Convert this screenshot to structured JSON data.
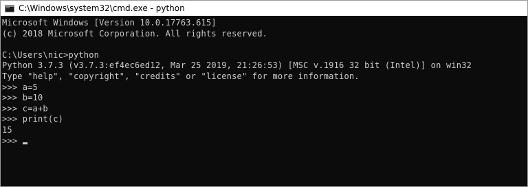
{
  "window": {
    "title": "C:\\Windows\\system32\\cmd.exe - python",
    "icon": "cmd-icon"
  },
  "console": {
    "lines": [
      "Microsoft Windows [Version 10.0.17763.615]",
      "(c) 2018 Microsoft Corporation. All rights reserved.",
      "",
      "C:\\Users\\nic>python",
      "Python 3.7.3 (v3.7.3:ef4ec6ed12, Mar 25 2019, 21:26:53) [MSC v.1916 32 bit (Intel)] on win32",
      "Type \"help\", \"copyright\", \"credits\" or \"license\" for more information.",
      ">>> a=5",
      ">>> b=10",
      ">>> c=a+b",
      ">>> print(c)",
      "15"
    ],
    "prompt": ">>> "
  },
  "colors": {
    "console_bg": "#0c0c0c",
    "console_text": "#cccccc",
    "titlebar_bg": "#ffffff"
  }
}
